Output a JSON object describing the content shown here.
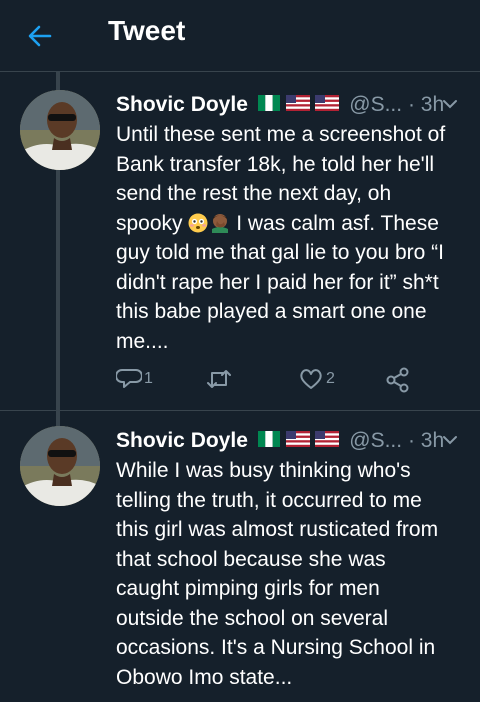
{
  "header": {
    "title": "Tweet"
  },
  "tweets": [
    {
      "name": "Shovic Doyle",
      "handle": "@S...",
      "dot": "·",
      "time": "3h",
      "text_a": "Until these sent me a screenshot of\nBank transfer 18k, he told her he'll\nsend the rest the next day, oh\nspooky ",
      "text_b": " I was calm asf. These\nguy told me that gal lie to you bro “I\ndidn't rape her I paid her for it” sh*t\nthis babe played a smart one one\nme....",
      "emojis": [
        "flushed-face-emoji",
        "facepalm-emoji"
      ],
      "actions": {
        "reply_count": "1",
        "retweet_count": "",
        "like_count": "2"
      }
    },
    {
      "name": "Shovic Doyle",
      "handle": "@S...",
      "dot": "·",
      "time": "3h",
      "text": "While I was busy thinking who's\ntelling the truth, it occurred to me\nthis girl was almost rusticated from\nthat school because she was\ncaught pimping girls for men\noutside the school on several\noccasions. It's a Nursing School in\nObowo Imo state..."
    }
  ],
  "colors": {
    "background": "#15202b",
    "accent": "#1da1f2",
    "muted": "#8899a6",
    "divider": "#38444d"
  },
  "icons": [
    "back-arrow-icon",
    "chevron-down-icon",
    "reply-icon",
    "retweet-icon",
    "like-icon",
    "share-icon"
  ],
  "flags": [
    "nigeria-flag",
    "usa-flag",
    "usa-flag"
  ]
}
